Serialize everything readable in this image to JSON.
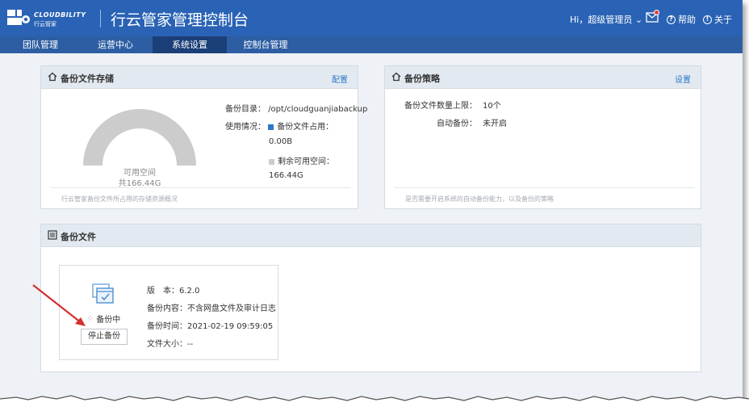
{
  "header": {
    "logo_en": "CLOUDBILITY",
    "logo_cn": "行云管家",
    "title": "行云管家管理控制台",
    "greeting": "Hi，超级管理员",
    "help": "帮助",
    "about": "关于"
  },
  "nav": {
    "items": [
      {
        "label": "团队管理",
        "active": false
      },
      {
        "label": "运营中心",
        "active": false
      },
      {
        "label": "系统设置",
        "active": true
      },
      {
        "label": "控制台管理",
        "active": false
      }
    ]
  },
  "storage_panel": {
    "title": "备份文件存储",
    "link": "配置",
    "gauge_available_label": "可用空间",
    "gauge_total": "共166.44G",
    "dir_label": "备份目录：",
    "dir_value": "/opt/cloudguanjiabackup",
    "usage_label": "使用情况：",
    "used_label": "备份文件占用：",
    "used_value": "0.00B",
    "free_label": "剩余可用空间：",
    "free_value": "166.44G",
    "footer": "行云管家备份文件所占用的存储资源概况",
    "used_color": "#2a78c8",
    "free_color": "#cccccc"
  },
  "policy_panel": {
    "title": "备份策略",
    "link": "设置",
    "max_label": "备份文件数量上限：",
    "max_value": "10个",
    "auto_label": "自动备份：",
    "auto_value": "未开启",
    "footer": "是否需要开启系统的自动备份能力，以及备份的策略"
  },
  "files_panel": {
    "title": "备份文件",
    "status": "备份中",
    "stop_button": "停止备份",
    "version": "版　本：6.2.0",
    "content": "备份内容：不含网盘文件及审计日志",
    "time": "备份时间：2021-02-19 09:59:05",
    "size": "文件大小：--"
  },
  "colors": {
    "topbar": "#2a63b5",
    "navbar": "#2d5ea3",
    "nav_active": "#1b3f78",
    "link": "#2a78c8",
    "annotation_arrow": "#d32f2f"
  }
}
